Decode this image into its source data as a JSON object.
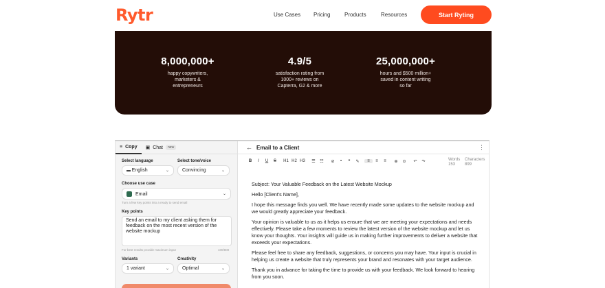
{
  "brand": {
    "logo": "Rytr",
    "accent": "#ff4b1f"
  },
  "nav": {
    "items": [
      "Use Cases",
      "Pricing",
      "Products",
      "Resources"
    ],
    "cta": "Start Ryting"
  },
  "stats": [
    {
      "value": "8,000,000+",
      "caption": [
        "happy copywriters,",
        "marketers &",
        "entrepreneurs"
      ]
    },
    {
      "value": "4.9/5",
      "caption": [
        "satisfaction rating from",
        "1000+ reviews on",
        "Capterra, G2 & more"
      ]
    },
    {
      "value": "25,000,000+",
      "caption": [
        "hours and $500 million+",
        "saved in content writing",
        "so far"
      ]
    }
  ],
  "sidebar": {
    "tab_copy": "Copy",
    "tab_chat": "Chat",
    "tab_chat_badge": "new",
    "language_label": "Select language",
    "language_value": "English",
    "tone_label": "Select tone/voice",
    "tone_value": "Convincing",
    "usecase_label": "Choose use case",
    "usecase_value": "Email",
    "usecase_hint": "Turn a few key points into a ready to send email",
    "keypoints_label": "Key points",
    "keypoints_value": "Send an email to my client asking them for feedback on the most recent version of the website mockup",
    "keypoints_hint": "For best results provide maximum input",
    "keypoints_count": "100/800",
    "variants_label": "Variants",
    "variants_value": "1 variant",
    "creativity_label": "Creativity",
    "creativity_value": "Optimal"
  },
  "editor": {
    "title": "Email to a Client",
    "toolbar": [
      "B",
      "I",
      "U",
      "S",
      "H1",
      "H2",
      "H3",
      "list-bulleted-icon",
      "list-numbered-icon",
      "link-icon",
      "image-icon",
      "quote-icon",
      "highlighter-icon",
      "align-left-icon",
      "align-center-icon",
      "align-right-icon",
      "clear-format-icon",
      "history-icon",
      "undo-icon",
      "redo-icon"
    ],
    "words_label": "Words",
    "words_value": "153",
    "chars_label": "Characters",
    "chars_value": "899",
    "paragraphs": [
      "Subject: Your Valuable Feedback on the Latest Website Mockup",
      "Hello [Client's Name],",
      "I hope this message finds you well. We have recently made some updates to the website mockup and we would greatly appreciate your feedback.",
      "Your opinion is valuable to us as it helps us ensure that we are meeting your expectations and needs effectively. Please take a few moments to review the latest version of the website mockup and let us know your thoughts. Your insights will guide us in making further improvements to deliver a website that exceeds your expectations.",
      "Please feel free to share any feedback, suggestions, or concerns you may have. Your input is crucial in helping us create a website that truly represents your brand and resonates with your target audience.",
      "Thank you in advance for taking the time to provide us with your feedback. We look forward to hearing from you soon."
    ]
  }
}
